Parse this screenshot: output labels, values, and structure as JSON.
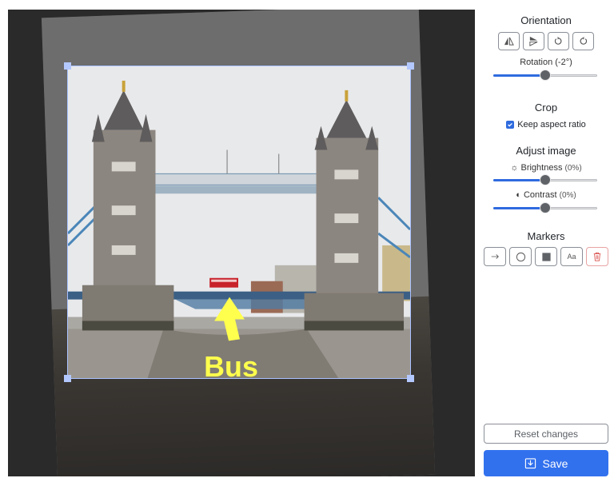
{
  "canvas": {
    "annotation_text": "Bus",
    "annotation_color": "#ffff4d",
    "crop_border_color": "#a9c1ff"
  },
  "panel": {
    "orientation": {
      "title": "Orientation",
      "buttons": [
        {
          "name": "flip-horizontal",
          "icon": "flip-horizontal-icon"
        },
        {
          "name": "flip-vertical",
          "icon": "flip-vertical-icon"
        },
        {
          "name": "rotate-left",
          "icon": "rotate-ccw-icon"
        },
        {
          "name": "rotate-right",
          "icon": "rotate-cw-icon"
        }
      ],
      "rotation_label": "Rotation (-2°)",
      "rotation_value": -2,
      "rotation_fraction": 0.5
    },
    "crop": {
      "title": "Crop",
      "keep_aspect_label": "Keep aspect ratio",
      "keep_aspect_checked": true
    },
    "adjust": {
      "title": "Adjust image",
      "brightness_label": "Brightness",
      "brightness_pct": "(0%)",
      "brightness_fraction": 0.5,
      "contrast_label": "Contrast",
      "contrast_pct": "(0%)",
      "contrast_fraction": 0.5
    },
    "markers": {
      "title": "Markers",
      "buttons": [
        {
          "name": "arrow",
          "icon": "arrow-right-icon"
        },
        {
          "name": "circle",
          "icon": "circle-icon"
        },
        {
          "name": "rectangle",
          "icon": "square-icon"
        },
        {
          "name": "text",
          "icon": "text-icon",
          "label": "Aa"
        },
        {
          "name": "delete",
          "icon": "trash-icon"
        }
      ]
    },
    "reset_label": "Reset changes",
    "save_label": "Save",
    "accent_color": "#3271ee"
  }
}
